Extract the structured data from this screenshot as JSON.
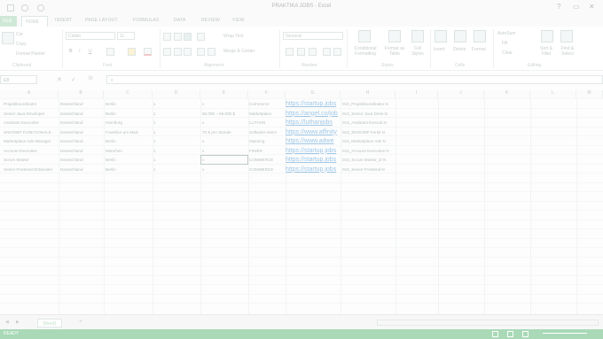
{
  "window": {
    "title": "PRAKTIKA JOBS - Excel",
    "min": "?",
    "max": "▭",
    "close": "✕"
  },
  "ribbon": {
    "tabs": {
      "file": "FILE",
      "home": "HOME",
      "insert": "INSERT",
      "page_layout": "PAGE LAYOUT",
      "formulas": "FORMULAS",
      "data": "DATA",
      "review": "REVIEW",
      "view": "VIEW"
    },
    "clipboard": {
      "cut": "Cut",
      "copy": "Copy",
      "format_painter": "Format Painter",
      "group": "Clipboard"
    },
    "font": {
      "name": "Calibri",
      "size": "11",
      "bold": "B",
      "italic": "I",
      "underline": "U",
      "group": "Font"
    },
    "alignment": {
      "wrap": "Wrap Text",
      "merge": "Merge & Center",
      "group": "Alignment"
    },
    "number": {
      "format": "General",
      "group": "Number"
    },
    "styles": {
      "conditional": "Conditional Formatting",
      "format_table": "Format as Table",
      "cell_styles": "Cell Styles",
      "group": "Styles"
    },
    "cells": {
      "insert": "Insert",
      "delete": "Delete",
      "format": "Format",
      "group": "Cells"
    },
    "editing": {
      "autosum": "AutoSum",
      "fill": "Fill",
      "clear": "Clear",
      "sort": "Sort & Filter",
      "find": "Find & Select",
      "group": "Editing"
    }
  },
  "formula_bar": {
    "name_box": "E8",
    "fx": "fx",
    "value": "x"
  },
  "columns": [
    "A",
    "B",
    "C",
    "D",
    "E",
    "F",
    "G",
    "H",
    "I",
    "J",
    "K",
    "L",
    "M"
  ],
  "rows": [
    {
      "a": "Projektkoordinator",
      "b": "Deutschland",
      "c": "Berlin",
      "d": "1",
      "e": "x",
      "f": "Commerce",
      "g": "https://startup.jobs",
      "h": "018_Projektkoordinator.N"
    },
    {
      "a": "Senior Java Developer",
      "b": "Deutschland",
      "c": "Berlin",
      "d": "1",
      "e": "60.000 – 65.000 $",
      "f": "Marketplace",
      "g": "https://angel.co/job",
      "h": "018_Senior Java Deve.N"
    },
    {
      "a": "Assistant Executive",
      "b": "Deutschland",
      "c": "Hamburg",
      "d": "1",
      "e": "x",
      "f": "LUTHAN",
      "g": "https://luthanjobs",
      "h": "018_Assistant Executi.N"
    },
    {
      "a": "SNOOMP FUNKTIONALE",
      "b": "Deutschland",
      "c": "Frankfurt am Main",
      "d": "1",
      "e": "70 € pro Stunde",
      "f": "Software Intern",
      "g": "https://www.affinity",
      "h": "018_SNOOMP Funkt N"
    },
    {
      "a": "Marketplace Ads Manager",
      "b": "Deutschland",
      "c": "Berlin",
      "d": "1",
      "e": "x",
      "f": "Opening",
      "g": "https://www.adwe",
      "h": "018_Marketplace Ads N"
    },
    {
      "a": "Account Executive",
      "b": "Deutschland",
      "c": "München",
      "d": "1",
      "e": "x",
      "f": "FINIER",
      "g": "https://startup.jobs",
      "h": "018_Account Executive N"
    },
    {
      "a": "Scrum Master",
      "b": "Deutschland",
      "c": "Berlin",
      "d": "1",
      "e": "x",
      "f": "COMMERCE",
      "g": "https://startup.jobs",
      "h": "018_Scrum Master_D N"
    },
    {
      "a": "Senior Frontend Entwickler",
      "b": "Deutschland",
      "c": "Berlin",
      "d": "1",
      "e": "x",
      "f": "COMMERCE",
      "g": "https://startup.jobs",
      "h": "018_Senior Frontend N"
    }
  ],
  "sheet": {
    "tab": "Sheet1",
    "add": "+"
  },
  "status": {
    "ready": "READY"
  },
  "colors": {
    "accent": "#a9d9b7",
    "link": "#9ec6e6"
  }
}
